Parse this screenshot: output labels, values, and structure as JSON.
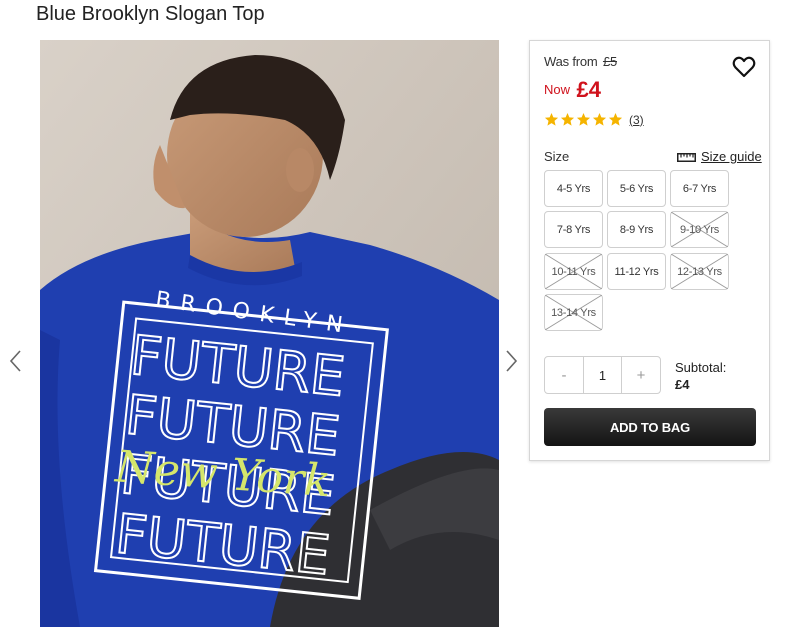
{
  "product": {
    "title": "Blue Brooklyn Slogan Top",
    "image_alt": "Boy wearing a blue Brooklyn Future slogan long-sleeve top",
    "print": {
      "line1": "BROOKLYN",
      "line2": "FUTURE",
      "script": "New York"
    }
  },
  "price": {
    "was_label": "Was from",
    "was_value": "£5",
    "now_label": "Now",
    "now_value": "£4",
    "accent_color": "#d0121c"
  },
  "rating": {
    "stars": 5,
    "max": 5,
    "review_count": "(3)",
    "star_color": "#f5b400"
  },
  "size": {
    "label": "Size",
    "guide_label": "Size guide",
    "options": [
      {
        "label": "4-5 Yrs",
        "available": true
      },
      {
        "label": "5-6 Yrs",
        "available": true
      },
      {
        "label": "6-7 Yrs",
        "available": true
      },
      {
        "label": "7-8 Yrs",
        "available": true
      },
      {
        "label": "8-9 Yrs",
        "available": true
      },
      {
        "label": "9-10 Yrs",
        "available": false
      },
      {
        "label": "10-11 Yrs",
        "available": false
      },
      {
        "label": "11-12 Yrs",
        "available": true
      },
      {
        "label": "12-13 Yrs",
        "available": false
      },
      {
        "label": "13-14 Yrs",
        "available": false
      }
    ]
  },
  "quantity": {
    "minus": "-",
    "value": "1",
    "plus": "+"
  },
  "subtotal": {
    "label": "Subtotal:",
    "value": "£4"
  },
  "cta": {
    "add_to_bag": "ADD TO BAG"
  },
  "icons": {
    "wishlist": "heart-outline-icon",
    "size_guide": "ruler-icon",
    "prev": "chevron-left-icon",
    "next": "chevron-right-icon"
  }
}
